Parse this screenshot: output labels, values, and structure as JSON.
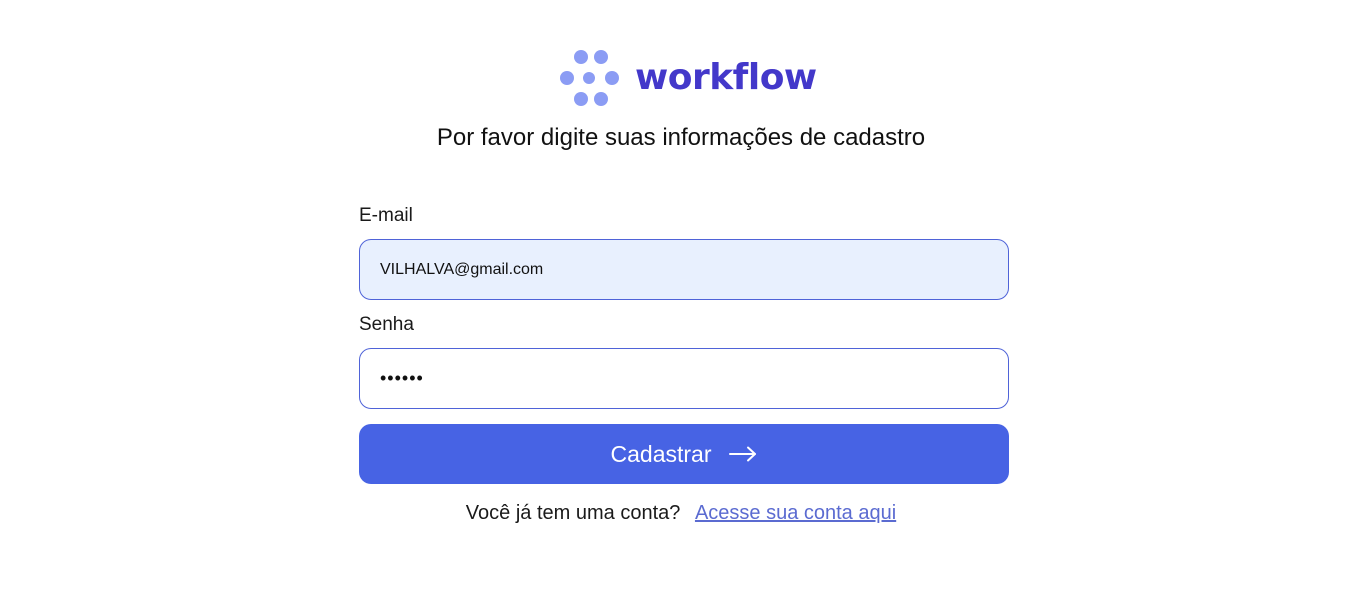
{
  "brand": {
    "name": "workflow",
    "logo_icon": "dots-logo-icon",
    "color": "#4338ca",
    "icon_color": "#8b9cf4"
  },
  "subtitle": "Por favor digite suas informações de cadastro",
  "form": {
    "email": {
      "label": "E-mail",
      "value": "VILHALVA@gmail.com"
    },
    "password": {
      "label": "Senha",
      "value": "••••••"
    },
    "submit": {
      "label": "Cadastrar",
      "icon": "arrow-right-icon",
      "color": "#4763e4"
    }
  },
  "footer": {
    "prompt": "Você já tem uma conta?",
    "link_label": "Acesse sua conta aqui",
    "link_color": "#5b6bd1"
  }
}
